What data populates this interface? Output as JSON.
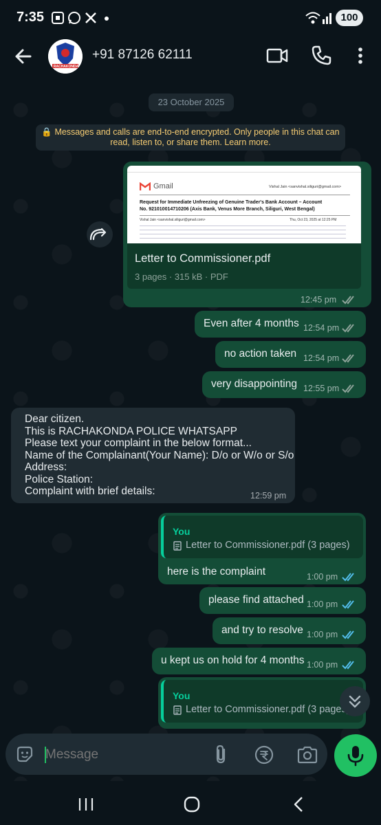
{
  "status_bar": {
    "time": "7:35",
    "battery": "100",
    "notification_icons": [
      "screenshot-icon",
      "whatsapp-icon",
      "x-icon"
    ]
  },
  "header": {
    "contact_name": "+91 87126 62111",
    "avatar_text": "RACHAKONDA POLICE",
    "back_icon": "arrow-left-icon",
    "video_icon": "video-camera-icon",
    "call_icon": "phone-icon",
    "menu_icon": "more-vertical-icon"
  },
  "chat": {
    "date_chip": "23 October 2025",
    "encryption_line1": "🔒 Messages and calls are end-to-end encrypted. Only people in this chat can",
    "encryption_line2": "read, listen to, or share them. Learn more.",
    "pdf_message": {
      "preview": {
        "gmail_label": "Gmail",
        "sender": "Vishal Jain <sanvishal.siliguri@gmail.com>",
        "subject_line1": "Request for Immediate Unfreezing of Genuine Trader's Bank Account – Account",
        "subject_line2": "No. 921010014710206 (Axis Bank, Venus More Branch, Siliguri, West Bengal)",
        "date_time": "Thu, Oct 23, 2025 at 12:25 PM"
      },
      "file_name": "Letter to Commissioner.pdf",
      "file_meta": "3 pages · 315 kB · PDF",
      "time": "12:45 pm"
    },
    "messages": [
      {
        "text": "Even after 4 months",
        "time": "12:54 pm"
      },
      {
        "text": "no action taken",
        "time": "12:54 pm"
      },
      {
        "text": "very disappointing",
        "time": "12:55 pm"
      }
    ],
    "incoming": {
      "lines": [
        "Dear citizen.",
        "This is RACHAKONDA POLICE WHATSAPP",
        "Please text your complaint in the below format...",
        "Name of the Complainant(Your Name): D/o or W/o or S/o",
        "Address:",
        "Police Station:",
        "Complaint with brief details:"
      ],
      "time": "12:59 pm"
    },
    "reply1": {
      "quote_author": "You",
      "quote_doc": "Letter to Commissioner.pdf (3 pages)",
      "text": "here is the complaint",
      "time": "1:00 pm"
    },
    "messages2": [
      {
        "text": "please find attached",
        "time": "1:00 pm"
      },
      {
        "text": "and try to resolve",
        "time": "1:00 pm"
      },
      {
        "text": "u kept us on hold for 4 months",
        "time": "1:00 pm"
      }
    ],
    "reply2": {
      "quote_author": "You",
      "quote_doc": "Letter to Commissioner.pdf (3 pages)"
    }
  },
  "input": {
    "placeholder": "Message"
  },
  "colors": {
    "background": "#0b141a",
    "outgoing_bubble": "#144d37",
    "incoming_bubble": "#202c33",
    "accent": "#21c063",
    "read_ticks": "#53bdeb"
  }
}
